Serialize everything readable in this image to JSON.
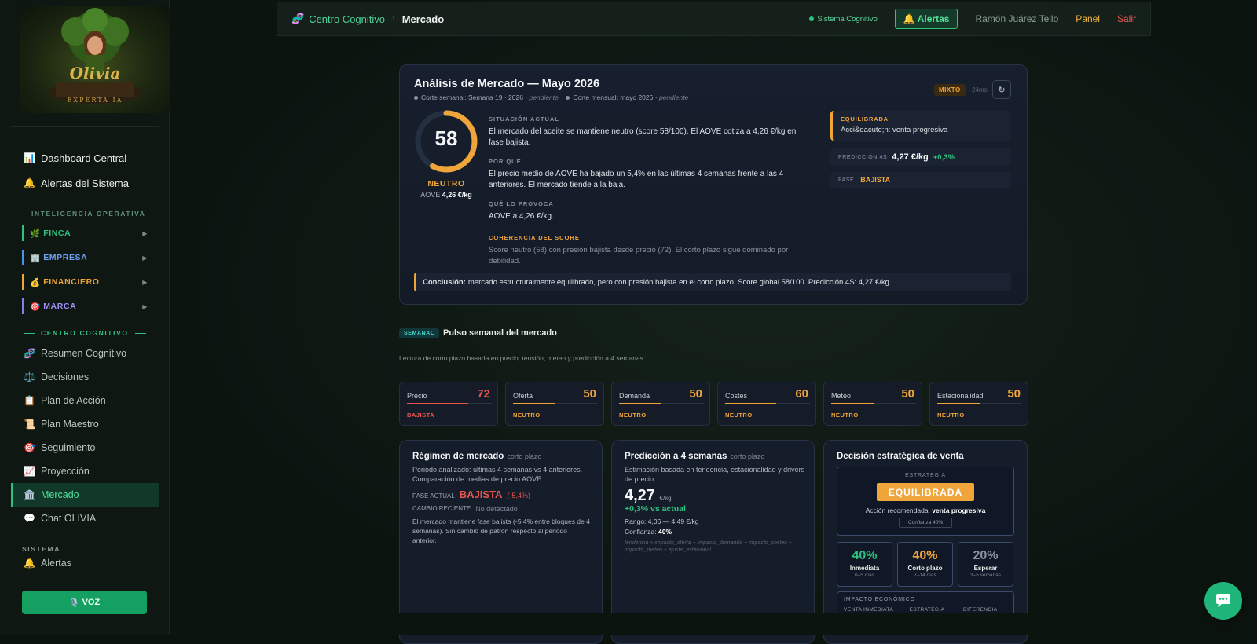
{
  "topbar": {
    "crumb_root": "Centro Cognitivo",
    "crumb_sep": "›",
    "crumb_current": "Mercado",
    "system_status": "Sistema Cognitivo",
    "alerts_label": "Alertas",
    "user_name": "Ramón Juárez Tello",
    "panel_label": "Panel",
    "logout_label": "Salir"
  },
  "sidebar": {
    "main_items": [
      {
        "label": "Dashboard Central",
        "icon": "chart-icon"
      },
      {
        "label": "Alertas del Sistema",
        "icon": "bell-icon"
      }
    ],
    "intel_header": "INTELIGENCIA OPERATIVA",
    "categories": [
      {
        "label": "FINCA",
        "icon": "🌿",
        "color": "#2ec27e"
      },
      {
        "label": "EMPRESA",
        "icon": "🏢",
        "color": "#4f8ff0"
      },
      {
        "label": "FINANCIERO",
        "icon": "💰",
        "color": "#f0a53a"
      },
      {
        "label": "MARCA",
        "icon": "🎯",
        "color": "#8a7cf0"
      }
    ],
    "cognitive_header": "CENTRO COGNITIVO",
    "cognitive_items": [
      {
        "label": "Resumen Cognitivo",
        "icon": "🧬"
      },
      {
        "label": "Decisiones",
        "icon": "⚖️"
      },
      {
        "label": "Plan de Acción",
        "icon": "📋"
      },
      {
        "label": "Plan Maestro",
        "icon": "📜"
      },
      {
        "label": "Seguimiento",
        "icon": "🎯"
      },
      {
        "label": "Proyección",
        "icon": "📈"
      },
      {
        "label": "Mercado",
        "icon": "🏛️"
      },
      {
        "label": "Chat OLIVIA",
        "icon": "💬"
      }
    ],
    "system_header": "SISTEMA",
    "system_item": "Alertas",
    "voice_button": "VOZ",
    "logo_text": "Olivia",
    "logo_subtext": "EXPERTA IA"
  },
  "hero": {
    "title": "Análisis de Mercado — Mayo 2026",
    "weekly_cut": "Corte semanal: Semana 19 · 2026 ·",
    "weekly_status": "pendiente",
    "monthly_cut": "Corte mensual: mayo 2026 ·",
    "monthly_status": "pendiente",
    "badge": "MIXTO",
    "timing": "24ms",
    "score": 58,
    "score_max": 100,
    "score_label": "NEUTRO",
    "aove_label": "AOVE",
    "aove_value": "4,26 €/kg",
    "situacion_label": "SITUACIÓN ACTUAL",
    "situacion_text": "El mercado del aceite se mantiene neutro (score 58/100). El AOVE cotiza a 4,26 €/kg en fase bajista.",
    "porque_label": "POR QUÉ",
    "porque_text": "El precio medio de AOVE ha bajado un 5,4% en las últimas 4 semanas frente a las 4 anteriores. El mercado tiende a la baja.",
    "provoca_label": "QUÉ LO PROVOCA",
    "provoca_text": "AOVE a 4,26 €/kg.",
    "coherencia_label": "COHERENCIA DEL SCORE",
    "coherencia_text": "Score neutro (58) con presión bajista desde precio (72). El corto plazo sigue dominado por debilidad.",
    "eq_label": "EQUILIBRADA",
    "eq_text": "Acci&oacute;n: venta progresiva",
    "pred_label": "PREDICCIÓN 4S",
    "pred_value": "4,27 €/kg",
    "pred_delta": "+0,3%",
    "fase_label": "FASE",
    "fase_value": "BAJISTA",
    "conclusion_label": "Conclusión:",
    "conclusion_text": "mercado estructuralmente equilibrado, pero con presión bajista en el corto plazo. Score global 58/100. Predicción 4S: 4,27 €/kg."
  },
  "semanal": {
    "tag": "SEMANAL",
    "title": "Pulso semanal del mercado",
    "desc": "Lectura de corto plazo basada en precio, tensión, meteo y predicción a 4 semanas.",
    "kpis": [
      {
        "name": "Precio",
        "value": 72,
        "status": "BAJISTA",
        "tone": "red"
      },
      {
        "name": "Oferta",
        "value": 50,
        "status": "NEUTRO",
        "tone": "orange"
      },
      {
        "name": "Demanda",
        "value": 50,
        "status": "NEUTRO",
        "tone": "orange"
      },
      {
        "name": "Costes",
        "value": 60,
        "status": "NEUTRO",
        "tone": "orange"
      },
      {
        "name": "Meteo",
        "value": 50,
        "status": "NEUTRO",
        "tone": "orange"
      },
      {
        "name": "Estacionalidad",
        "value": 50,
        "status": "NEUTRO",
        "tone": "orange"
      }
    ]
  },
  "regimen": {
    "title": "Régimen de mercado",
    "tag": "corto plazo",
    "desc": "Periodo analizado: últimas 4 semanas vs 4 anteriores. Comparación de medias de precio AOVE.",
    "fase_label": "FASE ACTUAL",
    "fase_value": "BAJISTA",
    "fase_delta": "(-5,4%)",
    "cambio_label": "CAMBIO RECIENTE",
    "cambio_value": "No detectado",
    "note": "El mercado mantiene fase bajista (-5,4% entre bloques de 4 semanas). Sin cambio de patrón respecto al periodo anterior."
  },
  "prediccion": {
    "title": "Predicción a 4 semanas",
    "tag": "corto plazo",
    "desc": "Estimación basada en tendencia, estacionalidad y drivers de precio.",
    "value": "4,27",
    "unit": "€/kg",
    "delta": "+0,3% vs actual",
    "range": "Rango: 4,06 — 4,49 €/kg",
    "conf_label": "Confianza:",
    "conf_value": "40%",
    "formula": "tendencia + impacto_oferta + impacto_demanda + impacto_costes + impacto_meteo + ajuste_estacional"
  },
  "decision": {
    "title": "Decisión estratégica de venta",
    "strategy_label": "ESTRATEGIA",
    "strategy_value": "EQUILIBRADA",
    "action_label": "Acción recomendada:",
    "action_value": "venta progresiva",
    "confidence": "Confianza 40%",
    "options": [
      {
        "pct": "40%",
        "name": "Inmediata",
        "days": "0–5 días",
        "color": "#2ec27e"
      },
      {
        "pct": "40%",
        "name": "Corto plazo",
        "days": "7–14 días",
        "color": "#f0a53a"
      },
      {
        "pct": "20%",
        "name": "Esperar",
        "days": "3–5 semanas",
        "color": "#8a93a3"
      }
    ],
    "impact_label": "IMPACTO ECONÓMICO",
    "impact_cols": [
      "VENTA INMEDIATA",
      "ESTRATEGIA",
      "DIFERENCIA"
    ]
  }
}
